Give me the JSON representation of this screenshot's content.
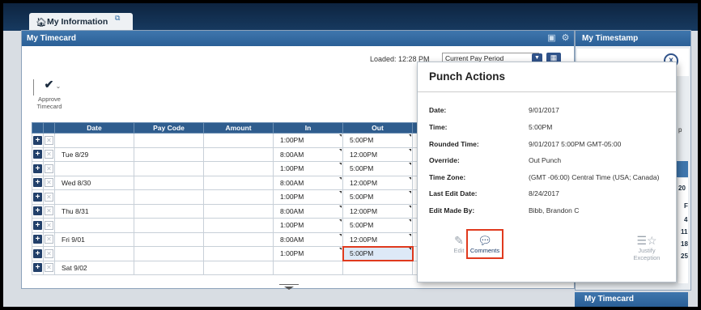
{
  "tab": {
    "label": "My Information",
    "home_icon": "home-icon",
    "popout_icon": "popout-icon"
  },
  "timecard": {
    "title": "My Timecard",
    "loaded_label": "Loaded: 12:28 PM",
    "pay_period": "Current Pay Period",
    "approve_label_line1": "Approve",
    "approve_label_line2": "Timecard",
    "columns": [
      "Date",
      "Pay Code",
      "Amount",
      "In",
      "Out"
    ],
    "rows": [
      {
        "date": "",
        "pay_code": "",
        "amount": "",
        "in": "1:00PM",
        "out": "5:00PM"
      },
      {
        "date": "Tue 8/29",
        "pay_code": "",
        "amount": "",
        "in": "8:00AM",
        "out": "12:00PM"
      },
      {
        "date": "",
        "pay_code": "",
        "amount": "",
        "in": "1:00PM",
        "out": "5:00PM"
      },
      {
        "date": "Wed 8/30",
        "pay_code": "",
        "amount": "",
        "in": "8:00AM",
        "out": "12:00PM"
      },
      {
        "date": "",
        "pay_code": "",
        "amount": "",
        "in": "1:00PM",
        "out": "5:00PM"
      },
      {
        "date": "Thu 8/31",
        "pay_code": "",
        "amount": "",
        "in": "8:00AM",
        "out": "12:00PM"
      },
      {
        "date": "",
        "pay_code": "",
        "amount": "",
        "in": "1:00PM",
        "out": "5:00PM"
      },
      {
        "date": "Fri 9/01",
        "pay_code": "",
        "amount": "",
        "in": "8:00AM",
        "out": "12:00PM"
      },
      {
        "date": "",
        "pay_code": "",
        "amount": "",
        "in": "1:00PM",
        "out": "5:00PM",
        "highlight_out": true
      },
      {
        "date": "Sat 9/02",
        "pay_code": "",
        "amount": "",
        "in": "",
        "out": ""
      }
    ]
  },
  "timestamp_panel": {
    "title": "My Timestamp",
    "close_label": "x",
    "edge_letter": "p",
    "edge_values": [
      "20",
      "F",
      "4",
      "11",
      "18",
      "25"
    ],
    "footer_title": "My Timecard"
  },
  "popup": {
    "title": "Punch Actions",
    "fields": [
      {
        "label": "Date:",
        "value": "9/01/2017"
      },
      {
        "label": "Time:",
        "value": "5:00PM"
      },
      {
        "label": "Rounded Time:",
        "value": "9/01/2017 5:00PM GMT-05:00"
      },
      {
        "label": "Override:",
        "value": "Out Punch"
      },
      {
        "label": "Time Zone:",
        "value": "(GMT -06:00) Central Time (USA; Canada)"
      },
      {
        "label": "Last Edit Date:",
        "value": "8/24/2017"
      },
      {
        "label": "Edit Made By:",
        "value": "Bibb, Brandon C"
      }
    ],
    "actions": [
      {
        "label": "Edit",
        "icon": "pencil-icon"
      },
      {
        "label": "Comments",
        "icon": "comment-icon"
      },
      {
        "label": "Justify Exception",
        "icon": "justify-exception-icon"
      }
    ]
  },
  "colors": {
    "header_blue": "#2f5d8e",
    "highlight_red": "#e03a1e"
  }
}
